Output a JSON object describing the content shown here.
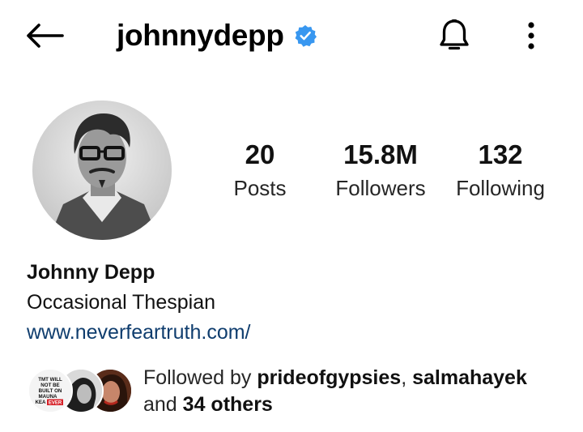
{
  "header": {
    "username": "johnnydepp",
    "icons": {
      "back": "arrow-left-icon",
      "verified": "verified-badge-icon",
      "notifications": "bell-icon",
      "more": "vertical-dots-icon"
    },
    "verified_color": "#3897f0"
  },
  "stats": {
    "posts": {
      "value": "20",
      "label": "Posts"
    },
    "followers": {
      "value": "15.8M",
      "label": "Followers"
    },
    "following": {
      "value": "132",
      "label": "Following"
    }
  },
  "bio": {
    "name": "Johnny Depp",
    "text": "Occasional Thespian",
    "link": "www.neverfeartruth.com/"
  },
  "followed_by": {
    "prefix": "Followed by ",
    "user1": "prideofgypsies",
    "separator": ", ",
    "user2": "salmahayek",
    "conjunction": "and ",
    "others": "34 others",
    "avatar1_text": "TMT WILL NOT BE BUILT ON MAUNA KEA",
    "avatar1_badge": "EVER"
  },
  "colors": {
    "link": "#0f3d6e",
    "text": "#262626",
    "badge_red": "#d62027"
  }
}
